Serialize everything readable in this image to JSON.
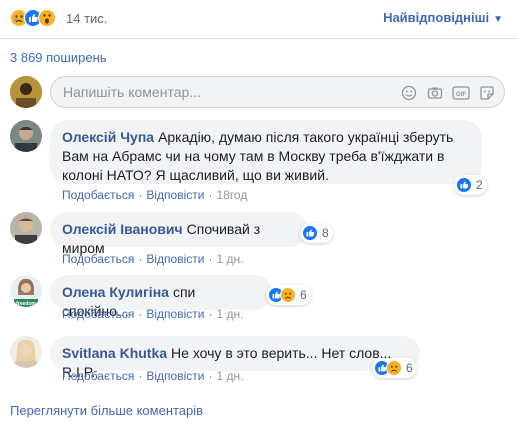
{
  "summary": {
    "reactions_count": "14 тис.",
    "sort_label": "Найвідповідніші",
    "shares_label": "3 869 поширень"
  },
  "composer": {
    "placeholder": "Напишіть коментар...",
    "icons": [
      "emoji-icon",
      "camera-icon",
      "gif-icon",
      "sticker-icon"
    ],
    "gif_label": "GIF"
  },
  "comments": [
    {
      "author": "Олексій Чупа",
      "text": "Аркадію, думаю після такого українці зберуть Вам на Абрамс чи на чому там в Москву треба в'їжджати в колоні НАТО? Я щасливий, що ви живий.",
      "like": "Подобається",
      "reply": "Відповісти",
      "time": "18год",
      "reactions_count": "2",
      "reactions": [
        "like"
      ]
    },
    {
      "author": "Олексій Іванович",
      "text": "Спочивай з миром",
      "like": "Подобається",
      "reply": "Відповісти",
      "time": "1 дн.",
      "reactions_count": "8",
      "reactions": [
        "like"
      ]
    },
    {
      "author": "Олена Кулигіна",
      "text": "спи спокійно...",
      "like": "Подобається",
      "reply": "Відповісти",
      "time": "1 дн.",
      "reactions_count": "6",
      "reactions": [
        "like",
        "sad"
      ],
      "avatar_badge": "freedom"
    },
    {
      "author": "Svitlana Khutka",
      "text": "Не хочу в это верить... Нет слов... R.I.P.",
      "like": "Подобається",
      "reply": "Відповісти",
      "time": "1 дн.",
      "reactions_count": "6",
      "reactions": [
        "like",
        "sad"
      ]
    }
  ],
  "more_comments_label": "Переглянути більше коментарів",
  "colors": {
    "link": "#4267b2",
    "author": "#385898",
    "bubble": "#f2f3f5",
    "like": "#1877f2",
    "sad": "#f7b125"
  }
}
